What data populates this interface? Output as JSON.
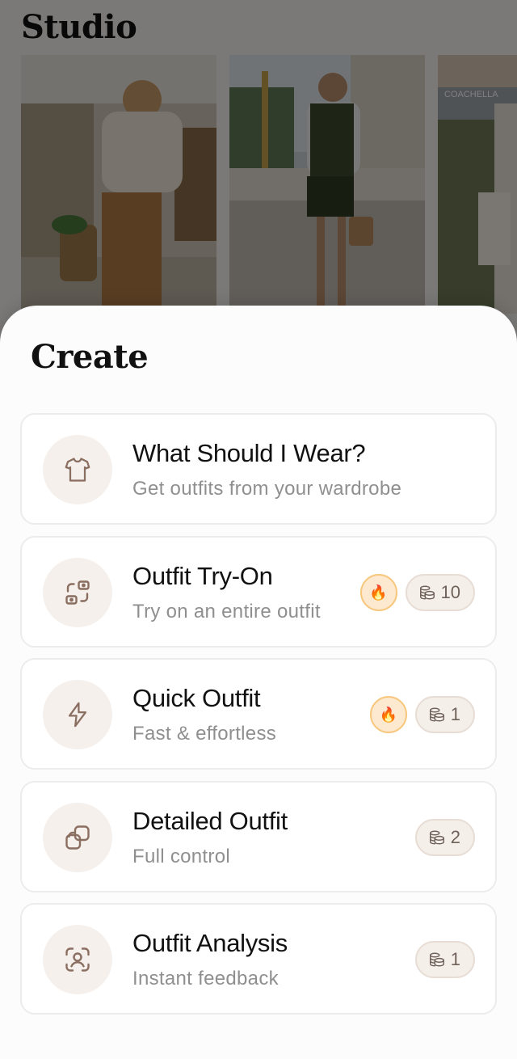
{
  "studio": {
    "title": "Studio",
    "photos": [
      "market-outfit-photo",
      "city-outfit-photo",
      "festival-outfit-photo"
    ],
    "festival_sign": "COACHELLA"
  },
  "create": {
    "title": "Create",
    "items": [
      {
        "title": "What Should I Wear?",
        "subtitle": "Get outfits from your wardrobe",
        "icon": "tshirt-icon",
        "hot": false,
        "credits": null
      },
      {
        "title": "Outfit Try-On",
        "subtitle": "Try on an entire outfit",
        "icon": "swap-icon",
        "hot": true,
        "credits": "10"
      },
      {
        "title": "Quick Outfit",
        "subtitle": "Fast & effortless",
        "icon": "lightning-icon",
        "hot": true,
        "credits": "1"
      },
      {
        "title": "Detailed Outfit",
        "subtitle": "Full control",
        "icon": "layers-icon",
        "hot": false,
        "credits": "2"
      },
      {
        "title": "Outfit Analysis",
        "subtitle": "Instant feedback",
        "icon": "scan-person-icon",
        "hot": false,
        "credits": "1"
      }
    ]
  },
  "colors": {
    "accent": "#8a6e60",
    "icon_bg": "#f5f0ec",
    "fire_bg": "#fde9cf",
    "credit_bg": "#f5efea"
  }
}
